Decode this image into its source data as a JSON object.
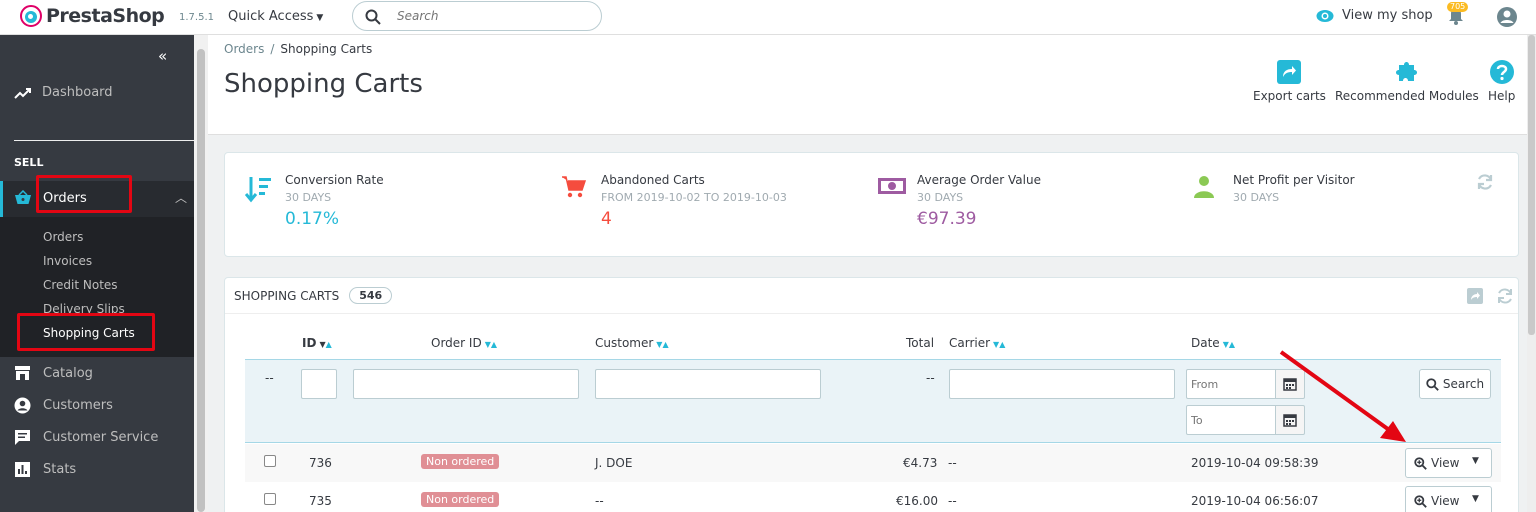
{
  "header": {
    "brand": "PrestaShop",
    "version": "1.7.5.1",
    "quick_access": "Quick Access",
    "search_placeholder": "Search",
    "view_shop": "View my shop",
    "notifications_count": "705"
  },
  "sidebar": {
    "dashboard": "Dashboard",
    "section": "SELL",
    "orders": "Orders",
    "submenu": [
      "Orders",
      "Invoices",
      "Credit Notes",
      "Delivery Slips",
      "Shopping Carts"
    ],
    "items": [
      "Catalog",
      "Customers",
      "Customer Service",
      "Stats"
    ]
  },
  "page": {
    "breadcrumb_parent": "Orders",
    "breadcrumb_sep": "/",
    "breadcrumb_current": "Shopping Carts",
    "title": "Shopping Carts",
    "toolbar": [
      "Export carts",
      "Recommended Modules",
      "Help"
    ]
  },
  "kpis": [
    {
      "title": "Conversion Rate",
      "sub": "30 DAYS",
      "value": "0.17%",
      "color": "#25b9d7"
    },
    {
      "title": "Abandoned Carts",
      "sub": "FROM 2019-10-02 TO 2019-10-03",
      "value": "4",
      "color": "#f54c3e"
    },
    {
      "title": "Average Order Value",
      "sub": "30 DAYS",
      "value": "€97.39",
      "color": "#9e5ba1"
    },
    {
      "title": "Net Profit per Visitor",
      "sub": "30 DAYS",
      "value": "",
      "color": "#8bc954"
    }
  ],
  "table": {
    "title": "SHOPPING CARTS",
    "count": "546",
    "columns": [
      "ID",
      "Order ID",
      "Customer",
      "Total",
      "Carrier",
      "Date"
    ],
    "filter": {
      "dash_left": "--",
      "dash_total": "--",
      "from_placeholder": "From",
      "to_placeholder": "To",
      "search_label": "Search"
    },
    "rows": [
      {
        "id": "736",
        "status": "Non ordered",
        "customer": "J. DOE",
        "total": "€4.73",
        "carrier": "--",
        "date": "2019-10-04 09:58:39",
        "action": "View"
      },
      {
        "id": "735",
        "status": "Non ordered",
        "customer": "--",
        "total": "€16.00",
        "carrier": "--",
        "date": "2019-10-04 06:56:07",
        "action": "View"
      }
    ]
  },
  "colors": {
    "accent": "#25b9d7",
    "highlight": "#e30613",
    "sidebar_bg": "#363a41"
  }
}
